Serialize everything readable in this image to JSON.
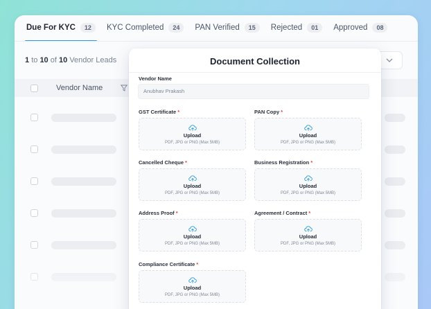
{
  "tabs": [
    {
      "label": "Due For KYC",
      "count": "12",
      "active": true
    },
    {
      "label": "KYC Completed",
      "count": "24",
      "active": false
    },
    {
      "label": "PAN Verified",
      "count": "15",
      "active": false
    },
    {
      "label": "Rejected",
      "count": "01",
      "active": false
    },
    {
      "label": "Approved",
      "count": "08",
      "active": false
    }
  ],
  "results": {
    "from": "1",
    "to_word": "to",
    "to": "10",
    "of_word": "of",
    "total": "10",
    "suffix": "Vendor Leads"
  },
  "table": {
    "column_vendor_name": "Vendor Name"
  },
  "icons": {
    "filter": "filter-icon",
    "chevron": "chevron-down-icon",
    "upload": "cloud-upload-icon"
  },
  "colors": {
    "accent": "#2d9bd8",
    "required": "#e0453a"
  },
  "modal": {
    "title": "Document Collection",
    "vendor_name_label": "Vendor Name",
    "vendor_name_value": "Anubhav Prakash",
    "upload_label": "Upload",
    "upload_hint": "PDF, JPG or PNG (Max 5MB)",
    "documents": [
      {
        "label": "GST Certificate",
        "required": "*"
      },
      {
        "label": "PAN Copy",
        "required": "*"
      },
      {
        "label": "Cancelled Cheque",
        "required": "*"
      },
      {
        "label": "Business Registration",
        "required": "*"
      },
      {
        "label": "Address Proof",
        "required": "*"
      },
      {
        "label": "Agreement / Contract",
        "required": "*"
      },
      {
        "label": "Compliance Certificate",
        "required": "*"
      }
    ]
  }
}
